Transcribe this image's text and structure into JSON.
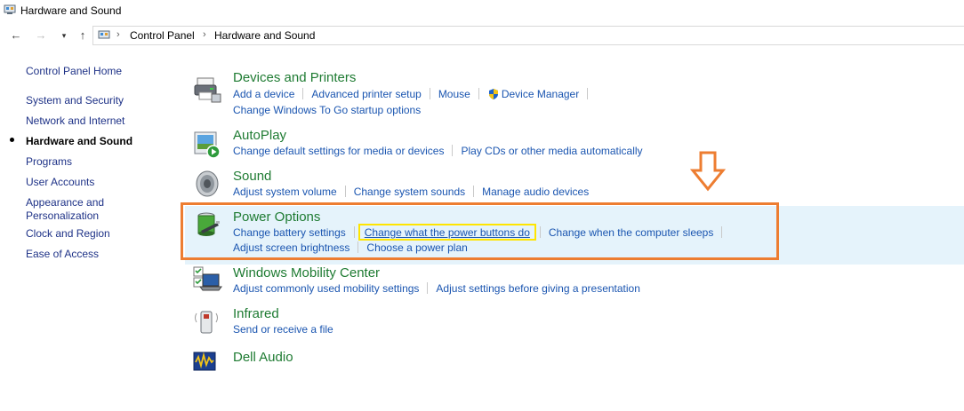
{
  "window": {
    "title": "Hardware and Sound"
  },
  "address_bar": {
    "crumbs": [
      "Control Panel",
      "Hardware and Sound"
    ]
  },
  "left_nav": {
    "home": "Control Panel Home",
    "items": [
      "System and Security",
      "Network and Internet",
      "Hardware and Sound",
      "Programs",
      "User Accounts",
      "Appearance and\nPersonalization",
      "Clock and Region",
      "Ease of Access"
    ],
    "active_index": 2
  },
  "categories": [
    {
      "title": "Devices and Printers",
      "icon": "printer-icon",
      "links_row1": [
        "Add a device",
        "Advanced printer setup",
        "Mouse",
        "Device Manager"
      ],
      "links_row2": [
        "Change Windows To Go startup options"
      ]
    },
    {
      "title": "AutoPlay",
      "icon": "autoplay-icon",
      "links_row1": [
        "Change default settings for media or devices",
        "Play CDs or other media automatically"
      ],
      "links_row2": []
    },
    {
      "title": "Sound",
      "icon": "speaker-icon",
      "links_row1": [
        "Adjust system volume",
        "Change system sounds",
        "Manage audio devices"
      ],
      "links_row2": []
    },
    {
      "title": "Power Options",
      "icon": "battery-icon",
      "links_row1": [
        "Change battery settings",
        "Change what the power buttons do",
        "Change when the computer sleeps"
      ],
      "links_row2": [
        "Adjust screen brightness",
        "Choose a power plan"
      ]
    },
    {
      "title": "Windows Mobility Center",
      "icon": "laptop-icon",
      "links_row1": [
        "Adjust commonly used mobility settings",
        "Adjust settings before giving a presentation"
      ],
      "links_row2": []
    },
    {
      "title": "Infrared",
      "icon": "infrared-icon",
      "links_row1": [
        "Send or receive a file"
      ],
      "links_row2": []
    },
    {
      "title": "Dell Audio",
      "icon": "dell-audio-icon",
      "links_row1": [],
      "links_row2": []
    }
  ],
  "colors": {
    "accent_orange": "#ed7d31",
    "highlight_yellow": "#ffe500",
    "category_green": "#1e7b32",
    "link_blue": "#1a55b0"
  }
}
